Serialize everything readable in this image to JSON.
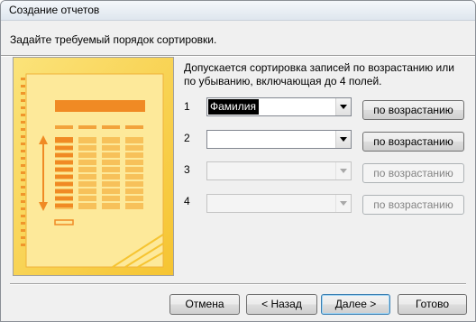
{
  "window": {
    "title": "Создание отчетов"
  },
  "header": {
    "prompt": "Задайте требуемый порядок сортировки."
  },
  "description": "Допускается сортировка записей по возрастанию или по убыванию, включающая до 4 полей.",
  "sort_rows": [
    {
      "number": "1",
      "field": "Фамилия",
      "order_label": "по возрастанию",
      "enabled": true
    },
    {
      "number": "2",
      "field": "",
      "order_label": "по возрастанию",
      "enabled": true
    },
    {
      "number": "3",
      "field": "",
      "order_label": "по возрастанию",
      "enabled": false
    },
    {
      "number": "4",
      "field": "",
      "order_label": "по возрастанию",
      "enabled": false
    }
  ],
  "buttons": {
    "cancel": "Отмена",
    "back": "< Назад",
    "next": "Далее >",
    "finish": "Готово"
  },
  "colors": {
    "illustration_bg": "#f9d94a",
    "illustration_panel": "#fde68f",
    "illustration_accent": "#f08a24"
  }
}
